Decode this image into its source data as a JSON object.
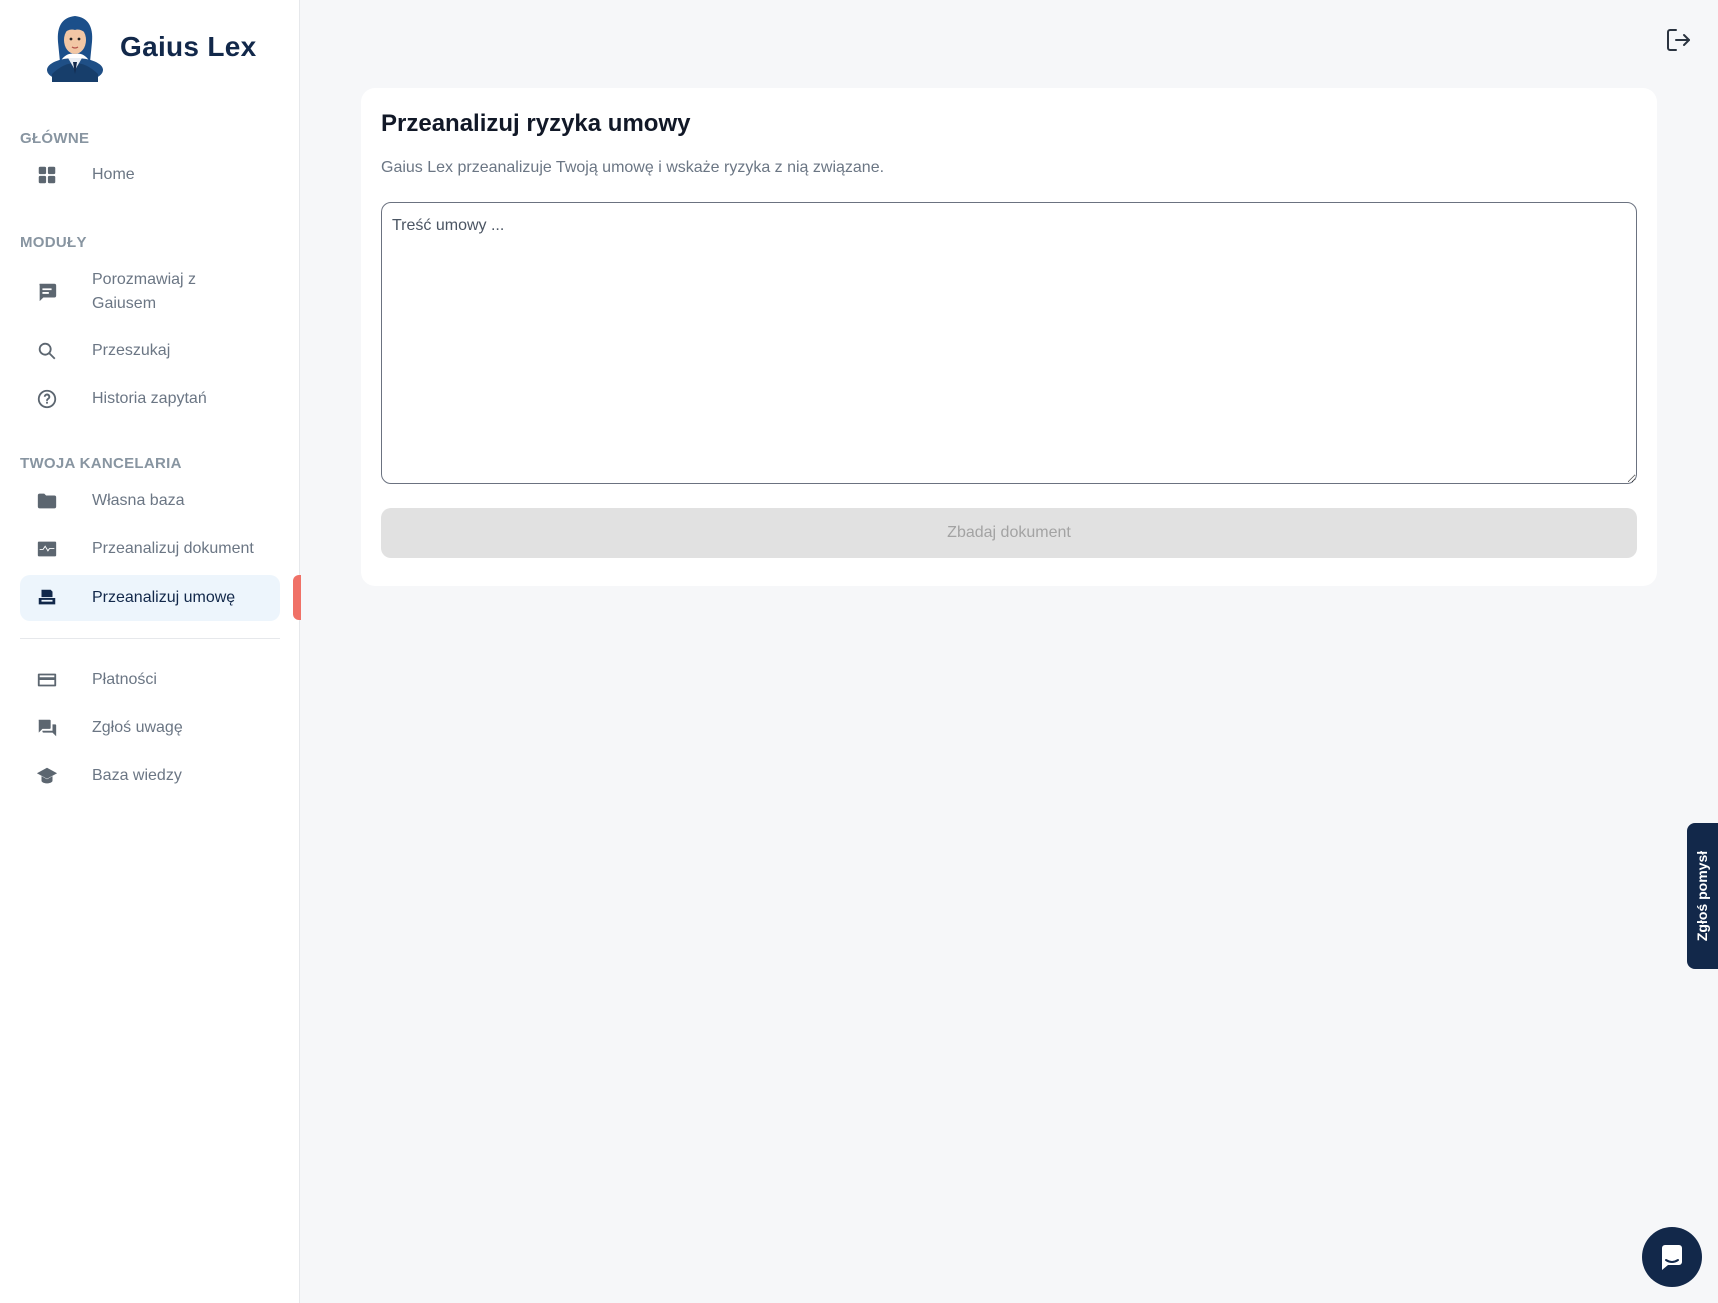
{
  "brand": {
    "name": "Gaius Lex"
  },
  "sidebar": {
    "sections": {
      "main": "GŁÓWNE",
      "modules": "MODUŁY",
      "office": "TWOJA KANCELARIA"
    },
    "items": {
      "home": "Home",
      "chat": "Porozmawiaj z Gaiusem",
      "search": "Przeszukaj",
      "history": "Historia zapytań",
      "own_base": "Własna baza",
      "analyze_doc": "Przeanalizuj dokument",
      "analyze_contract": "Przeanalizuj umowę",
      "payments": "Płatności",
      "feedback": "Zgłoś uwagę",
      "knowledge": "Baza wiedzy"
    },
    "active_item": "analyze_contract"
  },
  "main": {
    "title": "Przeanalizuj ryzyka umowy",
    "subtitle": "Gaius Lex przeanalizuje Twoją umowę i wskaże ryzyka z nią związane.",
    "textarea_value": "",
    "textarea_placeholder": "Treść umowy ...",
    "submit_label": "Zbadaj dokument",
    "submit_disabled": true
  },
  "side_tab": {
    "label": "Zgłoś pomysł"
  },
  "icons": {
    "logout": "logout-icon",
    "chat_widget": "chat-bubble-icon"
  },
  "colors": {
    "brand_navy": "#12284a",
    "active_bg": "#edf5fc",
    "active_marker": "#f07167"
  }
}
